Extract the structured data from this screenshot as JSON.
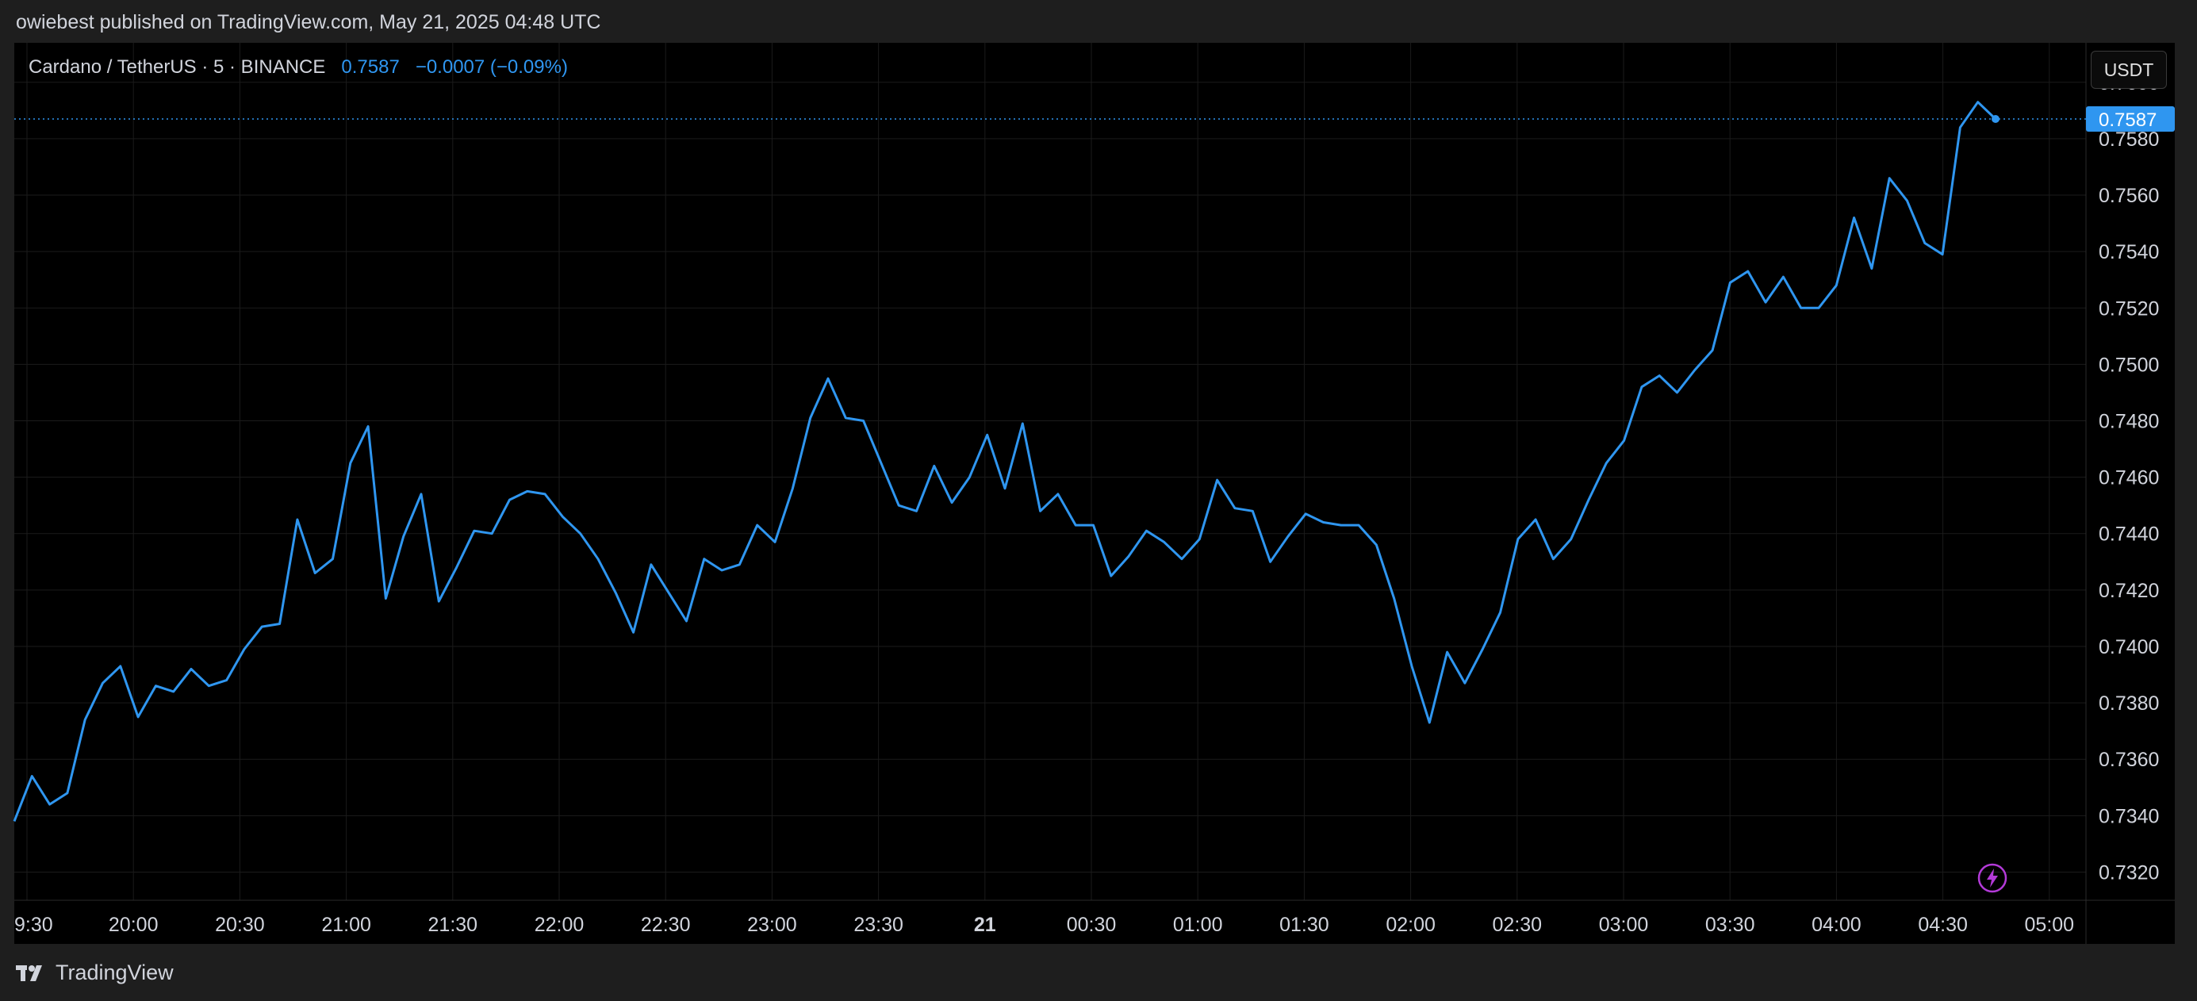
{
  "header": {
    "published": "owiebest published on TradingView.com, May 21, 2025 04:48 UTC"
  },
  "legend": {
    "symbol": "Cardano / TetherUS · 5 · BINANCE",
    "price": "0.7587",
    "change": "−0.0007 (−0.09%)"
  },
  "currency_button": "USDT",
  "footer": {
    "brand": "TradingView"
  },
  "icons": {
    "brand_logo": "tradingview-logo-icon",
    "lightning": "lightning-icon"
  },
  "colors": {
    "line": "#2f96f0",
    "price_label_bg": "#2f96f0",
    "grid": "#1b1b1b",
    "background": "#000000",
    "lightning": "#b33ad8"
  },
  "chart_data": {
    "type": "line",
    "title": "Cardano / TetherUS · 5 · BINANCE",
    "interval_minutes": 5,
    "x_tick_labels": [
      "9:30",
      "20:00",
      "20:30",
      "21:00",
      "21:30",
      "22:00",
      "22:30",
      "23:00",
      "23:30",
      "21",
      "00:30",
      "01:00",
      "01:30",
      "02:00",
      "02:30",
      "03:00",
      "03:30",
      "04:00",
      "04:30",
      "05:00"
    ],
    "y_tick_labels": [
      "0.7600",
      "0.7580",
      "0.7560",
      "0.7540",
      "0.7520",
      "0.7500",
      "0.7480",
      "0.7460",
      "0.7440",
      "0.7420",
      "0.7400",
      "0.7380",
      "0.7360",
      "0.7340",
      "0.7320"
    ],
    "ylim": [
      0.731,
      0.7614
    ],
    "last_price": 0.7587,
    "last_price_label": "0.7587",
    "grid": true,
    "series": [
      {
        "values": [
          0.7338,
          0.7354,
          0.7344,
          0.7348,
          0.7374,
          0.7387,
          0.7393,
          0.7375,
          0.7386,
          0.7384,
          0.7392,
          0.7386,
          0.7388,
          0.7399,
          0.7407,
          0.7408,
          0.7445,
          0.7426,
          0.7431,
          0.7465,
          0.7478,
          0.7417,
          0.7439,
          0.7454,
          0.7416,
          0.7428,
          0.7441,
          0.744,
          0.7452,
          0.7455,
          0.7454,
          0.7446,
          0.744,
          0.7431,
          0.7419,
          0.7405,
          0.7429,
          0.7419,
          0.7409,
          0.7431,
          0.7427,
          0.7429,
          0.7443,
          0.7437,
          0.7456,
          0.7481,
          0.7495,
          0.7481,
          0.748,
          0.7465,
          0.745,
          0.7448,
          0.7464,
          0.7451,
          0.746,
          0.7475,
          0.7456,
          0.7479,
          0.7448,
          0.7454,
          0.7443,
          0.7443,
          0.7425,
          0.7432,
          0.7441,
          0.7437,
          0.7431,
          0.7438,
          0.7459,
          0.7449,
          0.7448,
          0.743,
          0.7439,
          0.7447,
          0.7444,
          0.7443,
          0.7443,
          0.7436,
          0.7417,
          0.7393,
          0.7373,
          0.7398,
          0.7387,
          0.7399,
          0.7412,
          0.7438,
          0.7445,
          0.7431,
          0.7438,
          0.7452,
          0.7465,
          0.7473,
          0.7492,
          0.7496,
          0.749,
          0.7498,
          0.7505,
          0.7529,
          0.7533,
          0.7522,
          0.7531,
          0.752,
          0.752,
          0.7528,
          0.7552,
          0.7534,
          0.7566,
          0.7558,
          0.7543,
          0.7539,
          0.7584,
          0.7593,
          0.7587
        ]
      }
    ]
  }
}
